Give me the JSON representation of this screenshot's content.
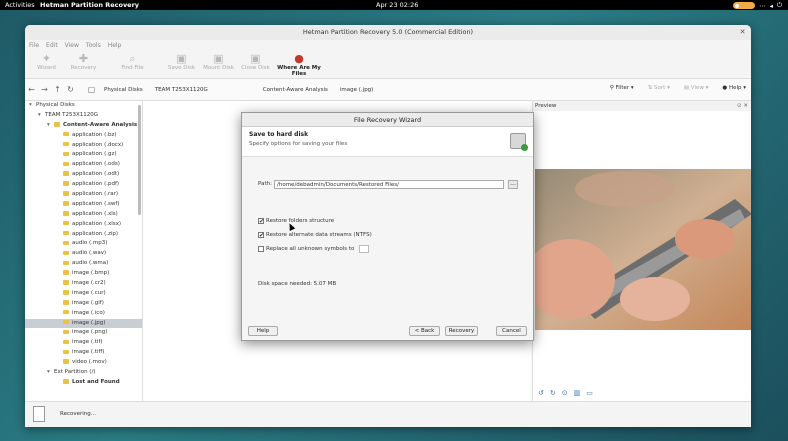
{
  "topbar": {
    "activities": "Activities",
    "app_name": "Hetman Partition Recovery",
    "clock": "Apr 23  02:26"
  },
  "window": {
    "title": "Hetman Partition Recovery 5.0 (Commercial Edition)"
  },
  "menu": [
    "File",
    "Edit",
    "View",
    "Tools",
    "Help"
  ],
  "toolbar": [
    {
      "label": "Wizard",
      "icon": "wand-icon"
    },
    {
      "label": "Recovery",
      "icon": "lifebuoy-icon"
    },
    {
      "label": "Find File",
      "icon": "search-icon"
    },
    {
      "label": "Save Disk",
      "icon": "save-disk-icon"
    },
    {
      "label": "Mount Disk",
      "icon": "mount-disk-icon"
    },
    {
      "label": "Close Disk",
      "icon": "close-disk-icon"
    },
    {
      "label": "Where Are My Files",
      "icon": "pin-icon"
    }
  ],
  "breadcrumb": [
    "Physical Disks",
    "TEAM T253X1120G",
    "Content-Aware Analysis",
    "image (.jpg)"
  ],
  "view_tools": {
    "filter": "Filter",
    "sort": "Sort",
    "view": "View",
    "help": "Help"
  },
  "tree": [
    {
      "label": "Physical Disks",
      "indent": 0,
      "bold": false,
      "folder": false
    },
    {
      "label": "TEAM T253X1120G",
      "indent": 1,
      "bold": false,
      "folder": false
    },
    {
      "label": "Content-Aware Analysis",
      "indent": 2,
      "bold": true,
      "folder": true
    },
    {
      "label": "application (.bz)",
      "indent": 3,
      "folder": true
    },
    {
      "label": "application (.docx)",
      "indent": 3,
      "folder": true
    },
    {
      "label": "application (.gz)",
      "indent": 3,
      "folder": true
    },
    {
      "label": "application (.ods)",
      "indent": 3,
      "folder": true
    },
    {
      "label": "application (.odt)",
      "indent": 3,
      "folder": true
    },
    {
      "label": "application (.pdf)",
      "indent": 3,
      "folder": true
    },
    {
      "label": "application (.rar)",
      "indent": 3,
      "folder": true
    },
    {
      "label": "application (.swf)",
      "indent": 3,
      "folder": true
    },
    {
      "label": "application (.xls)",
      "indent": 3,
      "folder": true
    },
    {
      "label": "application (.xlsx)",
      "indent": 3,
      "folder": true
    },
    {
      "label": "application (.zip)",
      "indent": 3,
      "folder": true
    },
    {
      "label": "audio (.mp3)",
      "indent": 3,
      "folder": true
    },
    {
      "label": "audio (.wav)",
      "indent": 3,
      "folder": true
    },
    {
      "label": "audio (.wma)",
      "indent": 3,
      "folder": true
    },
    {
      "label": "image (.bmp)",
      "indent": 3,
      "folder": true
    },
    {
      "label": "image (.cr2)",
      "indent": 3,
      "folder": true
    },
    {
      "label": "image (.cur)",
      "indent": 3,
      "folder": true
    },
    {
      "label": "image (.gif)",
      "indent": 3,
      "folder": true
    },
    {
      "label": "image (.ico)",
      "indent": 3,
      "folder": true
    },
    {
      "label": "image (.jpg)",
      "indent": 3,
      "folder": true,
      "selected": true
    },
    {
      "label": "image (.png)",
      "indent": 3,
      "folder": true
    },
    {
      "label": "image (.tif)",
      "indent": 3,
      "folder": true
    },
    {
      "label": "image (.tiff)",
      "indent": 3,
      "folder": true
    },
    {
      "label": "video (.mov)",
      "indent": 3,
      "folder": true
    },
    {
      "label": "Ext Partition (/)",
      "indent": 2,
      "folder": false
    },
    {
      "label": "Lost and Found",
      "indent": 3,
      "bold": true,
      "folder": true
    }
  ],
  "preview": {
    "title": "Preview"
  },
  "status": {
    "text": "Recovering..."
  },
  "dialog": {
    "title": "File Recovery Wizard",
    "heading": "Save to hard disk",
    "subheading": "Specify options for saving your files",
    "path_label": "Path:",
    "path_value": "/home/debadmin/Documents/Restored Files/",
    "browse": "...",
    "options": [
      {
        "label": "Restore folders structure",
        "checked": true
      },
      {
        "label": "Restore alternate data streams (NTFS)",
        "checked": true
      },
      {
        "label": "Replace all unknown symbols to",
        "checked": false
      }
    ],
    "disk_space": "Disk space needed: 5.07 MB",
    "buttons": {
      "help": "Help",
      "back": "< Back",
      "recovery": "Recovery",
      "cancel": "Cancel"
    }
  }
}
